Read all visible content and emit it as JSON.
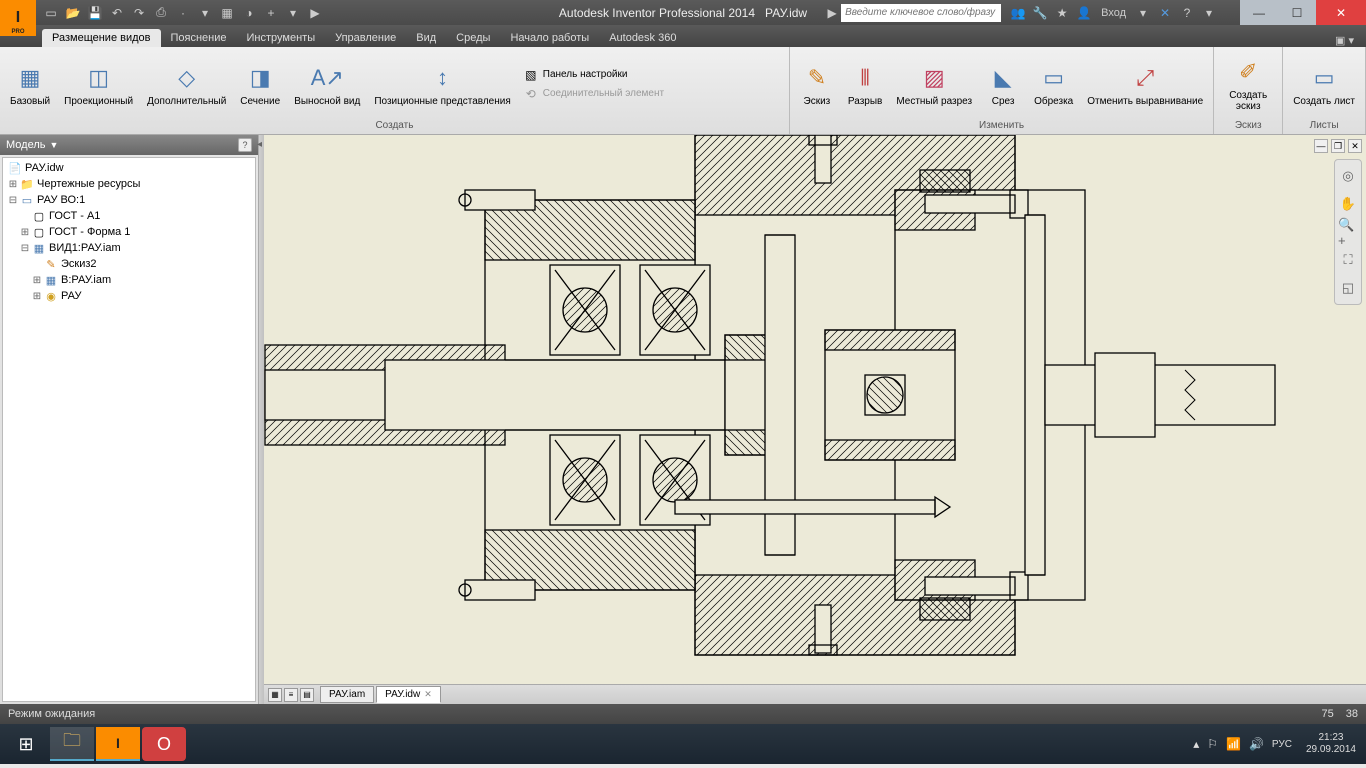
{
  "app": {
    "title": "Autodesk Inventor Professional 2014",
    "doc": "РАУ.idw",
    "search_placeholder": "Введите ключевое слово/фразу",
    "login": "Вход"
  },
  "tabs": {
    "placement": "Размещение видов",
    "explain": "Пояснение",
    "tools": "Инструменты",
    "manage": "Управление",
    "view": "Вид",
    "env": "Среды",
    "start": "Начало работы",
    "a360": "Autodesk 360"
  },
  "ribbon": {
    "create": {
      "label": "Создать",
      "base": "Базовый",
      "proj": "Проекционный",
      "aux": "Дополнительный",
      "section": "Сечение",
      "detail": "Выносной вид",
      "pos": "Позиционные представления",
      "panel": "Панель настройки",
      "connector": "Соединительный элемент"
    },
    "modify": {
      "label": "Изменить",
      "sketch": "Эскиз",
      "break": "Разрыв",
      "local": "Местный разрез",
      "cut": "Срез",
      "trim": "Обрезка",
      "unalign": "Отменить выравнивание"
    },
    "sketch_g": {
      "label": "Эскиз",
      "create": "Создать эскиз"
    },
    "sheets": {
      "label": "Листы",
      "create": "Создать лист"
    }
  },
  "model": {
    "title": "Модель",
    "root": "РАУ.idw",
    "resources": "Чертежные ресурсы",
    "rau_vo": "РАУ ВО:1",
    "gost_a1": "ГОСТ - А1",
    "gost_f1": "ГОСТ - Форма 1",
    "view1": "ВИД1:РАУ.iam",
    "esk2": "Эскиз2",
    "b_rau": "B:РАУ.iam",
    "rau": "РАУ"
  },
  "doc_tabs": {
    "tab1": "РАУ.iam",
    "tab2": "РАУ.idw"
  },
  "status": {
    "mode": "Режим ожидания",
    "v1": "75",
    "v2": "38"
  },
  "tray": {
    "lang": "РУС",
    "time": "21:23",
    "date": "29.09.2014"
  }
}
